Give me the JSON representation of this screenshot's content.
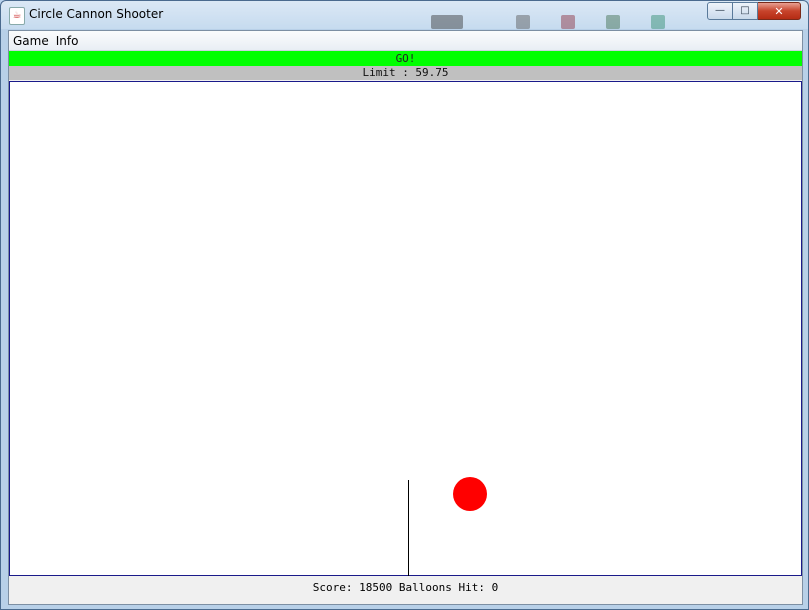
{
  "window": {
    "title": "Circle Cannon Shooter",
    "icon": "java-app-icon",
    "controls": {
      "minimize": "minimize-icon",
      "maximize": "maximize-icon",
      "close": "close-icon"
    }
  },
  "menu": {
    "items": [
      {
        "label": "Game"
      },
      {
        "label": "Info"
      }
    ]
  },
  "status": {
    "message": "GO!",
    "color": "#00ff00"
  },
  "limit": {
    "text": "Limit : 59.75"
  },
  "game": {
    "background": "#ffffff",
    "ball_color": "#ff0000",
    "cannon_color": "#000000"
  },
  "footer": {
    "text": "Score: 18500 Balloons Hit: 0"
  }
}
